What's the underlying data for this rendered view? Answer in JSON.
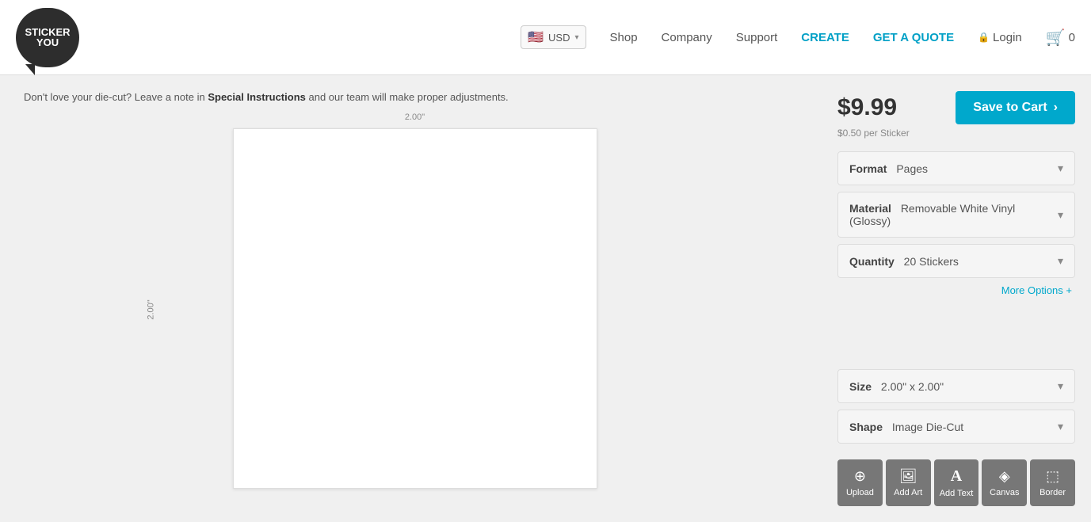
{
  "header": {
    "logo": {
      "line1": "STICKER",
      "line2": "YOU"
    },
    "currency": {
      "label": "USD",
      "flag": "🇺🇸"
    },
    "nav": {
      "shop": "Shop",
      "company": "Company",
      "support": "Support",
      "create": "CREATE",
      "quote": "GET A QUOTE",
      "login": "Login",
      "cart_count": "0"
    }
  },
  "canvas": {
    "notice_plain": "Don't love your die-cut?",
    "notice_mid": " Leave a note in ",
    "notice_highlight": "Special Instructions",
    "notice_end": " and our team will make proper adjustments.",
    "dim_top": "2.00\"",
    "dim_left": "2.00\""
  },
  "product": {
    "price": "$9.99",
    "price_per": "$0.50 per Sticker",
    "save_btn": "Save to Cart",
    "format_label": "Format",
    "format_value": "Pages",
    "material_label": "Material",
    "material_value": "Removable White Vinyl (Glossy)",
    "quantity_label": "Quantity",
    "quantity_value": "20 Stickers",
    "more_options": "More Options +",
    "size_label": "Size",
    "size_value": "2.00\" x 2.00\"",
    "shape_label": "Shape",
    "shape_value": "Image Die-Cut"
  },
  "toolbar": {
    "upload_label": "Upload",
    "add_art_label": "Add Art",
    "add_text_label": "Add Text",
    "canvas_label": "Canvas",
    "border_label": "Border",
    "upload_icon": "⊕",
    "add_art_icon": "🖼",
    "add_text_icon": "A",
    "canvas_icon": "◈",
    "border_icon": "⬜"
  }
}
